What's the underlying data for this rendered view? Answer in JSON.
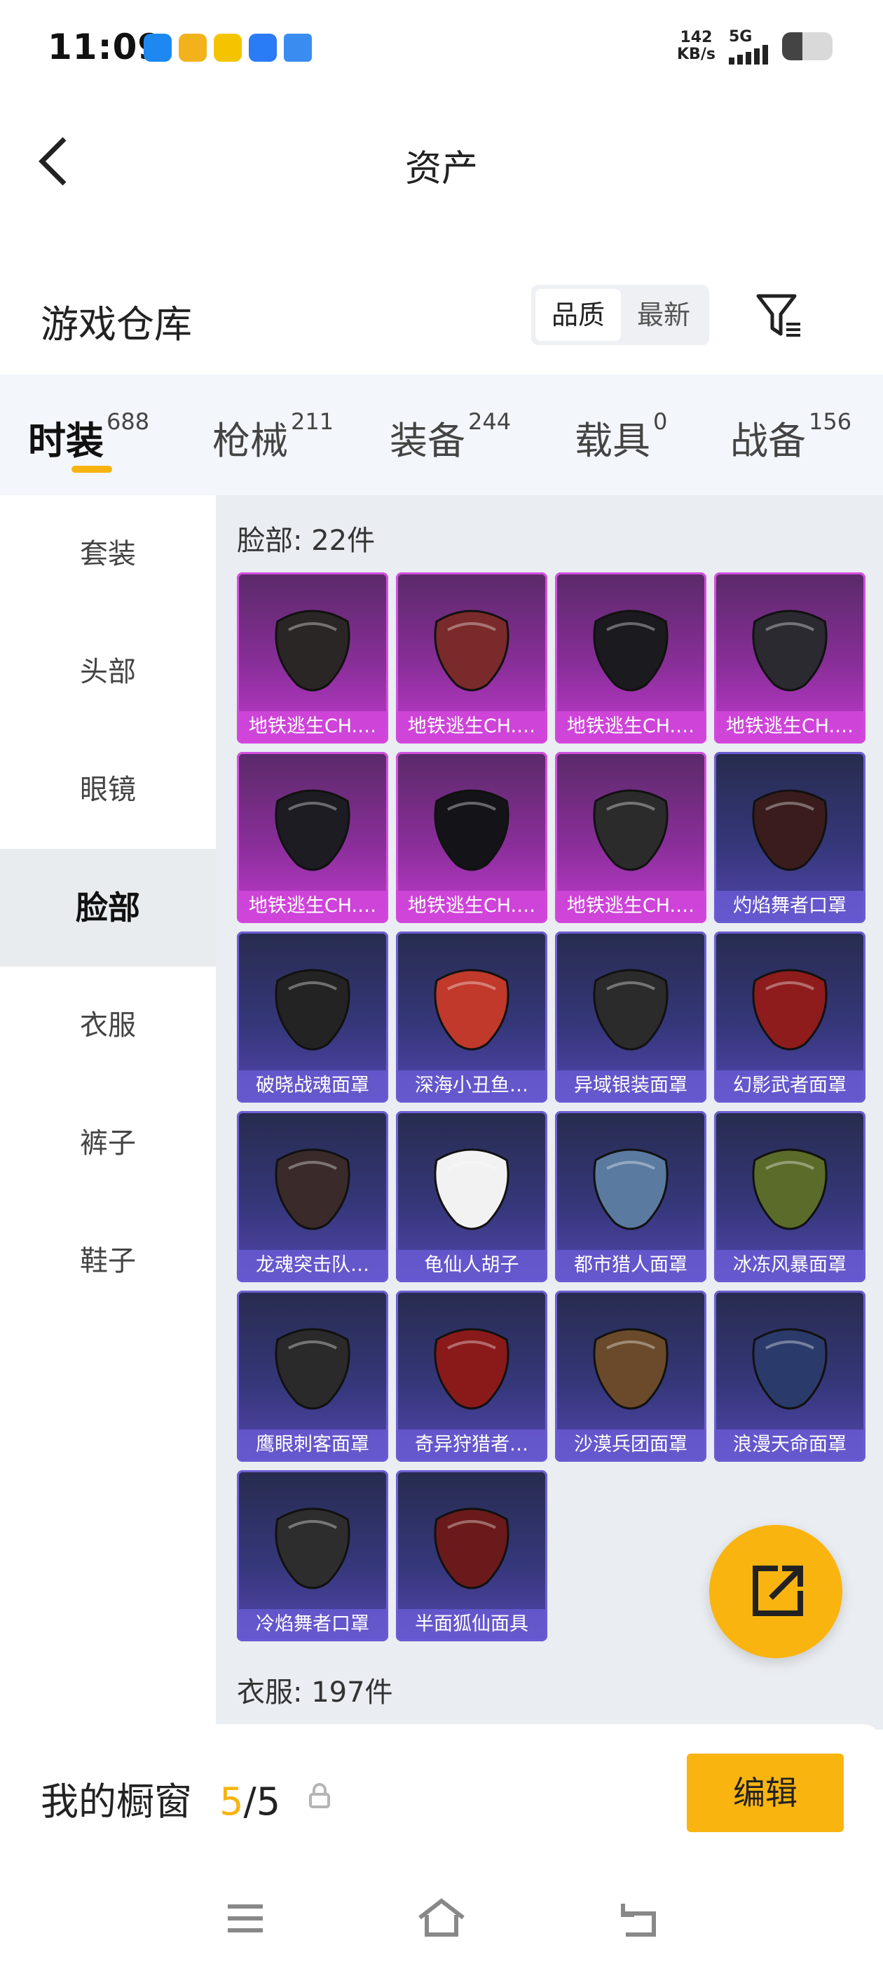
{
  "status_bar": {
    "time": "11:09",
    "speed_value": "142",
    "speed_unit": "KB/s",
    "network": "5G",
    "battery_level": 0.4,
    "app_icons": [
      "app-icon-blue",
      "app-icon-yellow-banner",
      "app-icon-yellow",
      "app-icon-du",
      "app-icon-chat"
    ]
  },
  "header": {
    "back_icon": "chevron-left-icon",
    "title": "资产"
  },
  "warehouse": {
    "title": "游戏仓库",
    "sort": {
      "quality": "品质",
      "latest": "最新",
      "selected": "品质"
    },
    "filter_icon": "filter-icon"
  },
  "tabs": [
    {
      "label": "时装",
      "count": "688",
      "active": true
    },
    {
      "label": "枪械",
      "count": "211",
      "active": false
    },
    {
      "label": "装备",
      "count": "244",
      "active": false
    },
    {
      "label": "载具",
      "count": "0",
      "active": false
    },
    {
      "label": "战备",
      "count": "156",
      "active": false
    }
  ],
  "sidebar": {
    "items": [
      {
        "label": "套装"
      },
      {
        "label": "头部"
      },
      {
        "label": "眼镜"
      },
      {
        "label": "脸部",
        "active": true
      },
      {
        "label": "衣服"
      },
      {
        "label": "裤子"
      },
      {
        "label": "鞋子"
      }
    ]
  },
  "content": {
    "face_section": "脸部: 22件",
    "clothes_section": "衣服: 197件",
    "items": [
      {
        "name": "地铁逃生CH.…",
        "rarity": "purple"
      },
      {
        "name": "地铁逃生CH.…",
        "rarity": "purple"
      },
      {
        "name": "地铁逃生CH.…",
        "rarity": "purple"
      },
      {
        "name": "地铁逃生CH.…",
        "rarity": "purple"
      },
      {
        "name": "地铁逃生CH.…",
        "rarity": "purple"
      },
      {
        "name": "地铁逃生CH.…",
        "rarity": "purple"
      },
      {
        "name": "地铁逃生CH.…",
        "rarity": "purple"
      },
      {
        "name": "灼焰舞者口罩",
        "rarity": "blue"
      },
      {
        "name": "破晓战魂面罩",
        "rarity": "blue"
      },
      {
        "name": "深海小丑鱼…",
        "rarity": "blue"
      },
      {
        "name": "异域银装面罩",
        "rarity": "blue"
      },
      {
        "name": "幻影武者面罩",
        "rarity": "blue"
      },
      {
        "name": "龙魂突击队…",
        "rarity": "blue"
      },
      {
        "name": "龟仙人胡子",
        "rarity": "blue"
      },
      {
        "name": "都市猎人面罩",
        "rarity": "blue"
      },
      {
        "name": "冰冻风暴面罩",
        "rarity": "blue"
      },
      {
        "name": "鹰眼刺客面罩",
        "rarity": "blue"
      },
      {
        "name": "奇异狩猎者…",
        "rarity": "blue"
      },
      {
        "name": "沙漠兵团面罩",
        "rarity": "blue"
      },
      {
        "name": "浪漫天命面罩",
        "rarity": "blue"
      },
      {
        "name": "冷焰舞者口罩",
        "rarity": "blue"
      },
      {
        "name": "半面狐仙面具",
        "rarity": "blue"
      }
    ]
  },
  "fab": {
    "icon": "share-external-icon"
  },
  "showcase": {
    "label": "我的橱窗",
    "current": "5",
    "sep_total": "/5",
    "lock_icon": "lock-icon",
    "edit_label": "编辑"
  },
  "nav": {
    "menu_icon": "menu-icon",
    "home_icon": "home-icon",
    "back_icon": "back-icon"
  },
  "colors": {
    "accent": "#f9b410",
    "purple_rarity": "#c33bd0",
    "blue_rarity": "#5446b0"
  }
}
